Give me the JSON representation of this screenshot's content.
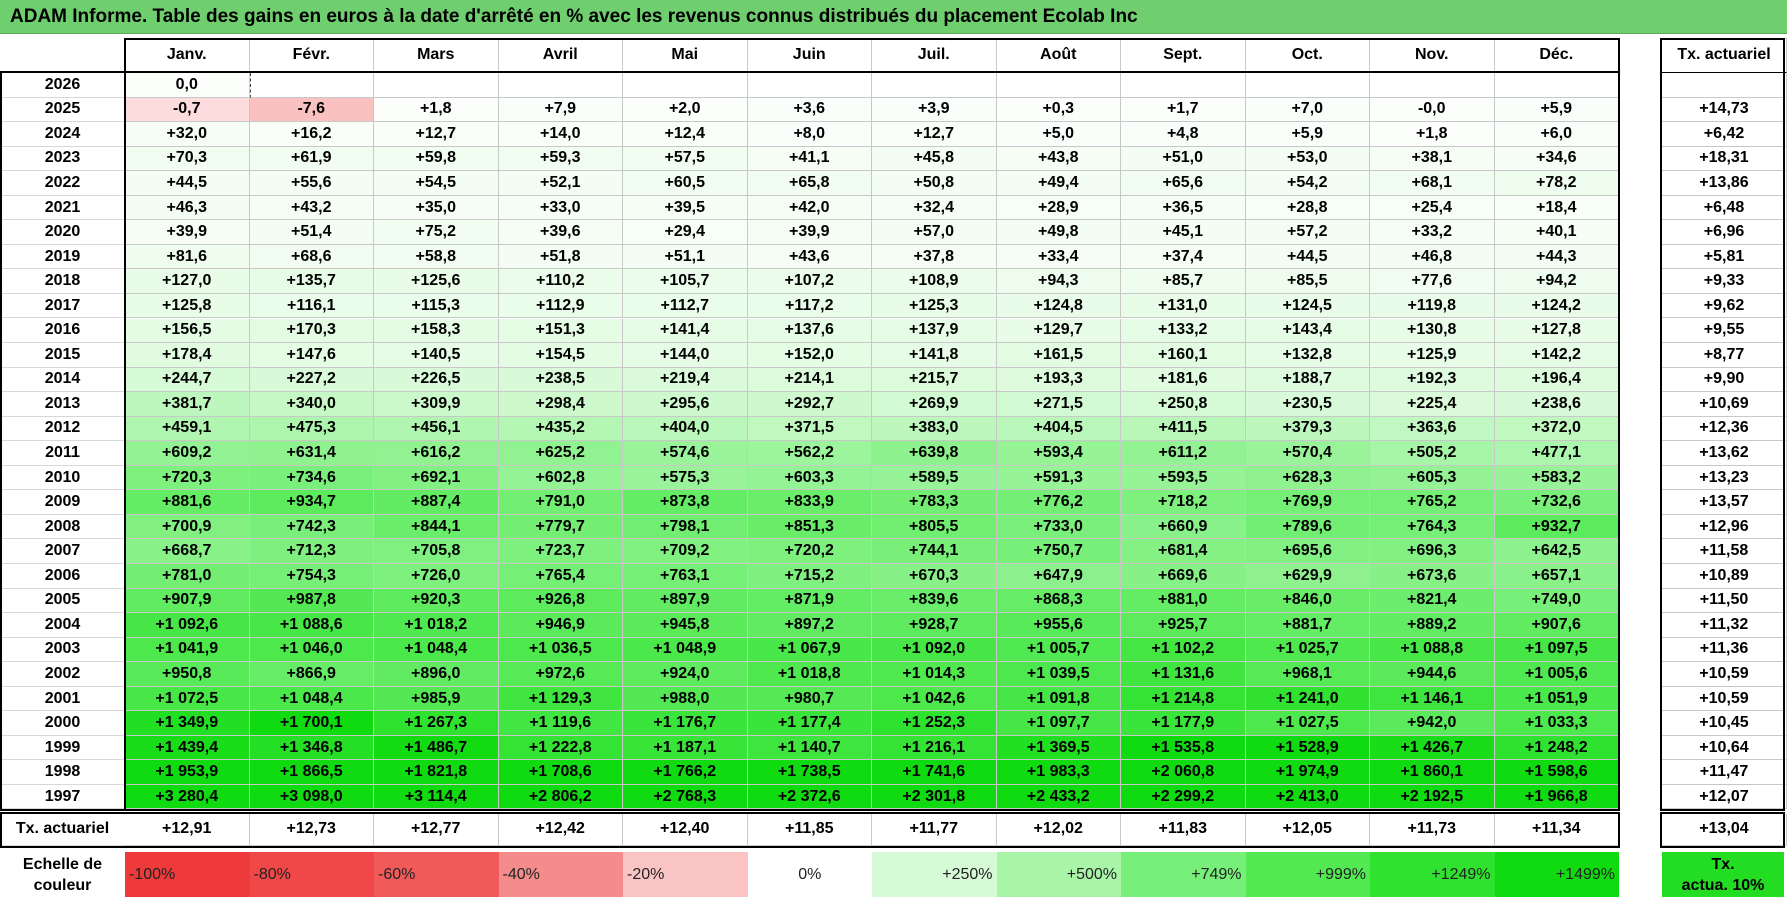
{
  "title": "ADAM Informe. Table des gains en euros à la date d'arrêté en % avec les revenus connus distribués du placement Ecolab Inc",
  "months": [
    "Janv.",
    "Févr.",
    "Mars",
    "Avril",
    "Mai",
    "Juin",
    "Juil.",
    "Août",
    "Sept.",
    "Oct.",
    "Nov.",
    "Déc."
  ],
  "tx_header": "Tx. actuariel",
  "tx_row_label": "Tx. actuariel",
  "rows": [
    {
      "year": "2026",
      "values": [
        "0,0",
        "",
        "",
        "",
        "",
        "",
        "",
        "",
        "",
        "",
        "",
        ""
      ],
      "tx": ""
    },
    {
      "year": "2025",
      "values": [
        "-0,7",
        "-7,6",
        "+1,8",
        "+7,9",
        "+2,0",
        "+3,6",
        "+3,9",
        "+0,3",
        "+1,7",
        "+7,0",
        "-0,0",
        "+5,9"
      ],
      "tx": "+14,73"
    },
    {
      "year": "2024",
      "values": [
        "+32,0",
        "+16,2",
        "+12,7",
        "+14,0",
        "+12,4",
        "+8,0",
        "+12,7",
        "+5,0",
        "+4,8",
        "+5,9",
        "+1,8",
        "+6,0"
      ],
      "tx": "+6,42"
    },
    {
      "year": "2023",
      "values": [
        "+70,3",
        "+61,9",
        "+59,8",
        "+59,3",
        "+57,5",
        "+41,1",
        "+45,8",
        "+43,8",
        "+51,0",
        "+53,0",
        "+38,1",
        "+34,6"
      ],
      "tx": "+18,31"
    },
    {
      "year": "2022",
      "values": [
        "+44,5",
        "+55,6",
        "+54,5",
        "+52,1",
        "+60,5",
        "+65,8",
        "+50,8",
        "+49,4",
        "+65,6",
        "+54,2",
        "+68,1",
        "+78,2"
      ],
      "tx": "+13,86"
    },
    {
      "year": "2021",
      "values": [
        "+46,3",
        "+43,2",
        "+35,0",
        "+33,0",
        "+39,5",
        "+42,0",
        "+32,4",
        "+28,9",
        "+36,5",
        "+28,8",
        "+25,4",
        "+18,4"
      ],
      "tx": "+6,48"
    },
    {
      "year": "2020",
      "values": [
        "+39,9",
        "+51,4",
        "+75,2",
        "+39,6",
        "+29,4",
        "+39,9",
        "+57,0",
        "+49,8",
        "+45,1",
        "+57,2",
        "+33,2",
        "+40,1"
      ],
      "tx": "+6,96"
    },
    {
      "year": "2019",
      "values": [
        "+81,6",
        "+68,6",
        "+58,8",
        "+51,8",
        "+51,1",
        "+43,6",
        "+37,8",
        "+33,4",
        "+37,4",
        "+44,5",
        "+46,8",
        "+44,3"
      ],
      "tx": "+5,81"
    },
    {
      "year": "2018",
      "values": [
        "+127,0",
        "+135,7",
        "+125,6",
        "+110,2",
        "+105,7",
        "+107,2",
        "+108,9",
        "+94,3",
        "+85,7",
        "+85,5",
        "+77,6",
        "+94,2"
      ],
      "tx": "+9,33"
    },
    {
      "year": "2017",
      "values": [
        "+125,8",
        "+116,1",
        "+115,3",
        "+112,9",
        "+112,7",
        "+117,2",
        "+125,3",
        "+124,8",
        "+131,0",
        "+124,5",
        "+119,8",
        "+124,2"
      ],
      "tx": "+9,62"
    },
    {
      "year": "2016",
      "values": [
        "+156,5",
        "+170,3",
        "+158,3",
        "+151,3",
        "+141,4",
        "+137,6",
        "+137,9",
        "+129,7",
        "+133,2",
        "+143,4",
        "+130,8",
        "+127,8"
      ],
      "tx": "+9,55"
    },
    {
      "year": "2015",
      "values": [
        "+178,4",
        "+147,6",
        "+140,5",
        "+154,5",
        "+144,0",
        "+152,0",
        "+141,8",
        "+161,5",
        "+160,1",
        "+132,8",
        "+125,9",
        "+142,2"
      ],
      "tx": "+8,77"
    },
    {
      "year": "2014",
      "values": [
        "+244,7",
        "+227,2",
        "+226,5",
        "+238,5",
        "+219,4",
        "+214,1",
        "+215,7",
        "+193,3",
        "+181,6",
        "+188,7",
        "+192,3",
        "+196,4"
      ],
      "tx": "+9,90"
    },
    {
      "year": "2013",
      "values": [
        "+381,7",
        "+340,0",
        "+309,9",
        "+298,4",
        "+295,6",
        "+292,7",
        "+269,9",
        "+271,5",
        "+250,8",
        "+230,5",
        "+225,4",
        "+238,6"
      ],
      "tx": "+10,69"
    },
    {
      "year": "2012",
      "values": [
        "+459,1",
        "+475,3",
        "+456,1",
        "+435,2",
        "+404,0",
        "+371,5",
        "+383,0",
        "+404,5",
        "+411,5",
        "+379,3",
        "+363,6",
        "+372,0"
      ],
      "tx": "+12,36"
    },
    {
      "year": "2011",
      "values": [
        "+609,2",
        "+631,4",
        "+616,2",
        "+625,2",
        "+574,6",
        "+562,2",
        "+639,8",
        "+593,4",
        "+611,2",
        "+570,4",
        "+505,2",
        "+477,1"
      ],
      "tx": "+13,62"
    },
    {
      "year": "2010",
      "values": [
        "+720,3",
        "+734,6",
        "+692,1",
        "+602,8",
        "+575,3",
        "+603,3",
        "+589,5",
        "+591,3",
        "+593,5",
        "+628,3",
        "+605,3",
        "+583,2"
      ],
      "tx": "+13,23"
    },
    {
      "year": "2009",
      "values": [
        "+881,6",
        "+934,7",
        "+887,4",
        "+791,0",
        "+873,8",
        "+833,9",
        "+783,3",
        "+776,2",
        "+718,2",
        "+769,9",
        "+765,2",
        "+732,6"
      ],
      "tx": "+13,57"
    },
    {
      "year": "2008",
      "values": [
        "+700,9",
        "+742,3",
        "+844,1",
        "+779,7",
        "+798,1",
        "+851,3",
        "+805,5",
        "+733,0",
        "+660,9",
        "+789,6",
        "+764,3",
        "+932,7"
      ],
      "tx": "+12,96"
    },
    {
      "year": "2007",
      "values": [
        "+668,7",
        "+712,3",
        "+705,8",
        "+723,7",
        "+709,2",
        "+720,2",
        "+744,1",
        "+750,7",
        "+681,4",
        "+695,6",
        "+696,3",
        "+642,5"
      ],
      "tx": "+11,58"
    },
    {
      "year": "2006",
      "values": [
        "+781,0",
        "+754,3",
        "+726,0",
        "+765,4",
        "+763,1",
        "+715,2",
        "+670,3",
        "+647,9",
        "+669,6",
        "+629,9",
        "+673,6",
        "+657,1"
      ],
      "tx": "+10,89"
    },
    {
      "year": "2005",
      "values": [
        "+907,9",
        "+987,8",
        "+920,3",
        "+926,8",
        "+897,9",
        "+871,9",
        "+839,6",
        "+868,3",
        "+881,0",
        "+846,0",
        "+821,4",
        "+749,0"
      ],
      "tx": "+11,50"
    },
    {
      "year": "2004",
      "values": [
        "+1 092,6",
        "+1 088,6",
        "+1 018,2",
        "+946,9",
        "+945,8",
        "+897,2",
        "+928,7",
        "+955,6",
        "+925,7",
        "+881,7",
        "+889,2",
        "+907,6"
      ],
      "tx": "+11,32"
    },
    {
      "year": "2003",
      "values": [
        "+1 041,9",
        "+1 046,0",
        "+1 048,4",
        "+1 036,5",
        "+1 048,9",
        "+1 067,9",
        "+1 092,0",
        "+1 005,7",
        "+1 102,2",
        "+1 025,7",
        "+1 088,8",
        "+1 097,5"
      ],
      "tx": "+11,36"
    },
    {
      "year": "2002",
      "values": [
        "+950,8",
        "+866,9",
        "+896,0",
        "+972,6",
        "+924,0",
        "+1 018,8",
        "+1 014,3",
        "+1 039,5",
        "+1 131,6",
        "+968,1",
        "+944,6",
        "+1 005,6"
      ],
      "tx": "+10,59"
    },
    {
      "year": "2001",
      "values": [
        "+1 072,5",
        "+1 048,4",
        "+985,9",
        "+1 129,3",
        "+988,0",
        "+980,7",
        "+1 042,6",
        "+1 091,8",
        "+1 214,8",
        "+1 241,0",
        "+1 146,1",
        "+1 051,9"
      ],
      "tx": "+10,59"
    },
    {
      "year": "2000",
      "values": [
        "+1 349,9",
        "+1 700,1",
        "+1 267,3",
        "+1 119,6",
        "+1 176,7",
        "+1 177,4",
        "+1 252,3",
        "+1 097,7",
        "+1 177,9",
        "+1 027,5",
        "+942,0",
        "+1 033,3"
      ],
      "tx": "+10,45"
    },
    {
      "year": "1999",
      "values": [
        "+1 439,4",
        "+1 346,8",
        "+1 486,7",
        "+1 222,8",
        "+1 187,1",
        "+1 140,7",
        "+1 216,1",
        "+1 369,5",
        "+1 535,8",
        "+1 528,9",
        "+1 426,7",
        "+1 248,2"
      ],
      "tx": "+10,64"
    },
    {
      "year": "1998",
      "values": [
        "+1 953,9",
        "+1 866,5",
        "+1 821,8",
        "+1 708,6",
        "+1 766,2",
        "+1 738,5",
        "+1 741,6",
        "+1 983,3",
        "+2 060,8",
        "+1 974,9",
        "+1 860,1",
        "+1 598,6"
      ],
      "tx": "+11,47"
    },
    {
      "year": "1997",
      "values": [
        "+3 280,4",
        "+3 098,0",
        "+3 114,4",
        "+2 806,2",
        "+2 768,3",
        "+2 372,6",
        "+2 301,8",
        "+2 433,2",
        "+2 299,2",
        "+2 413,0",
        "+2 192,5",
        "+1 966,8"
      ],
      "tx": "+12,07"
    }
  ],
  "tx_row": [
    "+12,91",
    "+12,73",
    "+12,77",
    "+12,42",
    "+12,40",
    "+11,85",
    "+11,77",
    "+12,02",
    "+11,83",
    "+12,05",
    "+11,73",
    "+11,34"
  ],
  "tx_total": "+13,04",
  "scale": {
    "label_line1": "Echelle de",
    "label_line2": "couleur",
    "items": [
      {
        "label": "-100%",
        "color": "#ee3a3a",
        "align": "left"
      },
      {
        "label": "-80%",
        "color": "#f04848",
        "align": "left"
      },
      {
        "label": "-60%",
        "color": "#f25a5a",
        "align": "left"
      },
      {
        "label": "-40%",
        "color": "#f58c8c",
        "align": "left"
      },
      {
        "label": "-20%",
        "color": "#fac4c4",
        "align": "left"
      },
      {
        "label": "0%",
        "color": "#ffffff",
        "align": "center"
      },
      {
        "label": "+250%",
        "color": "#d6fad6",
        "align": "right"
      },
      {
        "label": "+500%",
        "color": "#a8f5a8",
        "align": "right"
      },
      {
        "label": "+749%",
        "color": "#78ef78",
        "align": "right"
      },
      {
        "label": "+999%",
        "color": "#52e952",
        "align": "right"
      },
      {
        "label": "+1249%",
        "color": "#30e230",
        "align": "right"
      },
      {
        "label": "+1499%",
        "color": "#10db10",
        "align": "right"
      }
    ],
    "tx_line1": "Tx.",
    "tx_line2": "actua. 10%",
    "tx_color": "#22dd22"
  },
  "chart_data": {
    "type": "heatmap",
    "title": "ADAM Informe. Table des gains en euros à la date d'arrêté en % avec les revenus connus distribués du placement Ecolab Inc",
    "x_categories": [
      "Janv.",
      "Févr.",
      "Mars",
      "Avril",
      "Mai",
      "Juin",
      "Juil.",
      "Août",
      "Sept.",
      "Oct.",
      "Nov.",
      "Déc."
    ],
    "y_categories": [
      "2026",
      "2025",
      "2024",
      "2023",
      "2022",
      "2021",
      "2020",
      "2019",
      "2018",
      "2017",
      "2016",
      "2015",
      "2014",
      "2013",
      "2012",
      "2011",
      "2010",
      "2009",
      "2008",
      "2007",
      "2006",
      "2005",
      "2004",
      "2003",
      "2002",
      "2001",
      "2000",
      "1999",
      "1998",
      "1997"
    ],
    "color_scale": [
      "-100%",
      "-80%",
      "-60%",
      "-40%",
      "-20%",
      "0%",
      "+250%",
      "+500%",
      "+749%",
      "+999%",
      "+1249%",
      "+1499%"
    ]
  }
}
